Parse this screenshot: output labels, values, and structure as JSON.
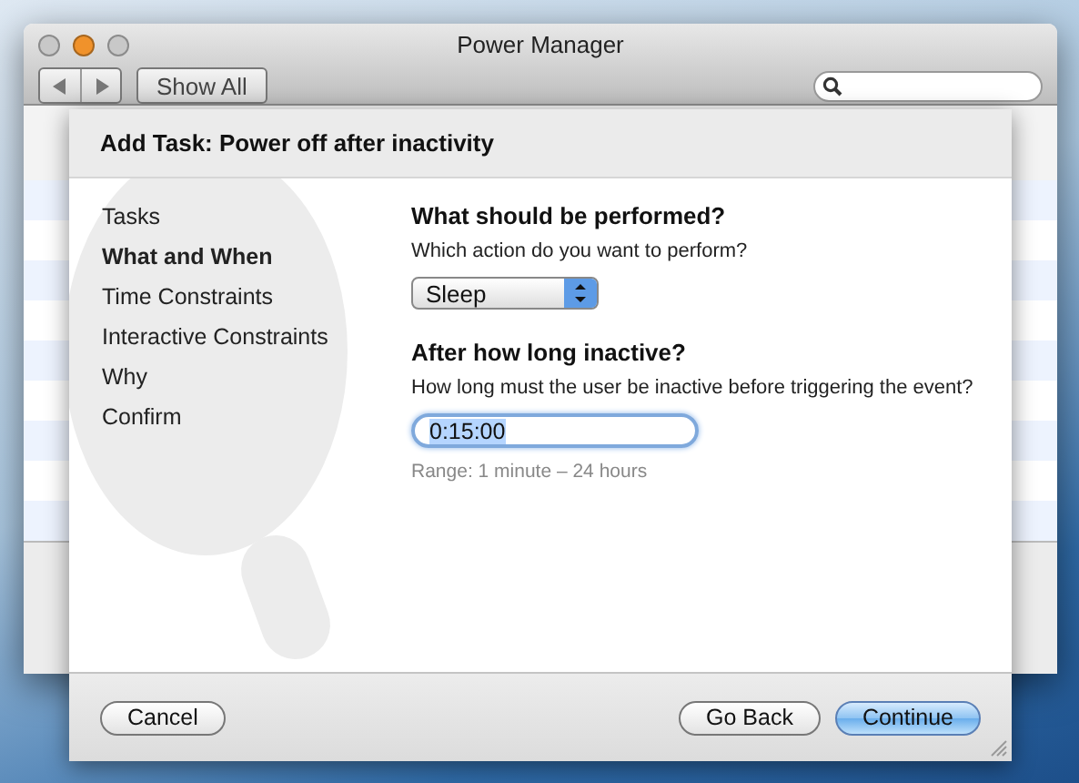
{
  "window": {
    "title": "Power Manager"
  },
  "toolbar": {
    "show_all": "Show All"
  },
  "sheet": {
    "title": "Add Task: Power off after inactivity",
    "steps": [
      {
        "label": "Tasks",
        "selected": false
      },
      {
        "label": "What and When",
        "selected": true
      },
      {
        "label": "Time Constraints",
        "selected": false
      },
      {
        "label": "Interactive Constraints",
        "selected": false
      },
      {
        "label": "Why",
        "selected": false
      },
      {
        "label": "Confirm",
        "selected": false
      }
    ],
    "sections": [
      {
        "kind": "popup",
        "heading": "What should be performed?",
        "prompt": "Which action do you want to perform?",
        "value": "Sleep"
      },
      {
        "kind": "text",
        "heading": "After how long inactive?",
        "prompt": "How long must the user be inactive before triggering the event?",
        "value": "0:15:00",
        "hint": "Range: 1 minute – 24 hours"
      }
    ],
    "buttons": [
      {
        "label": "Cancel",
        "kind": "plain"
      },
      {
        "label": "Go Back",
        "kind": "plain"
      },
      {
        "label": "Continue",
        "kind": "default"
      }
    ]
  }
}
